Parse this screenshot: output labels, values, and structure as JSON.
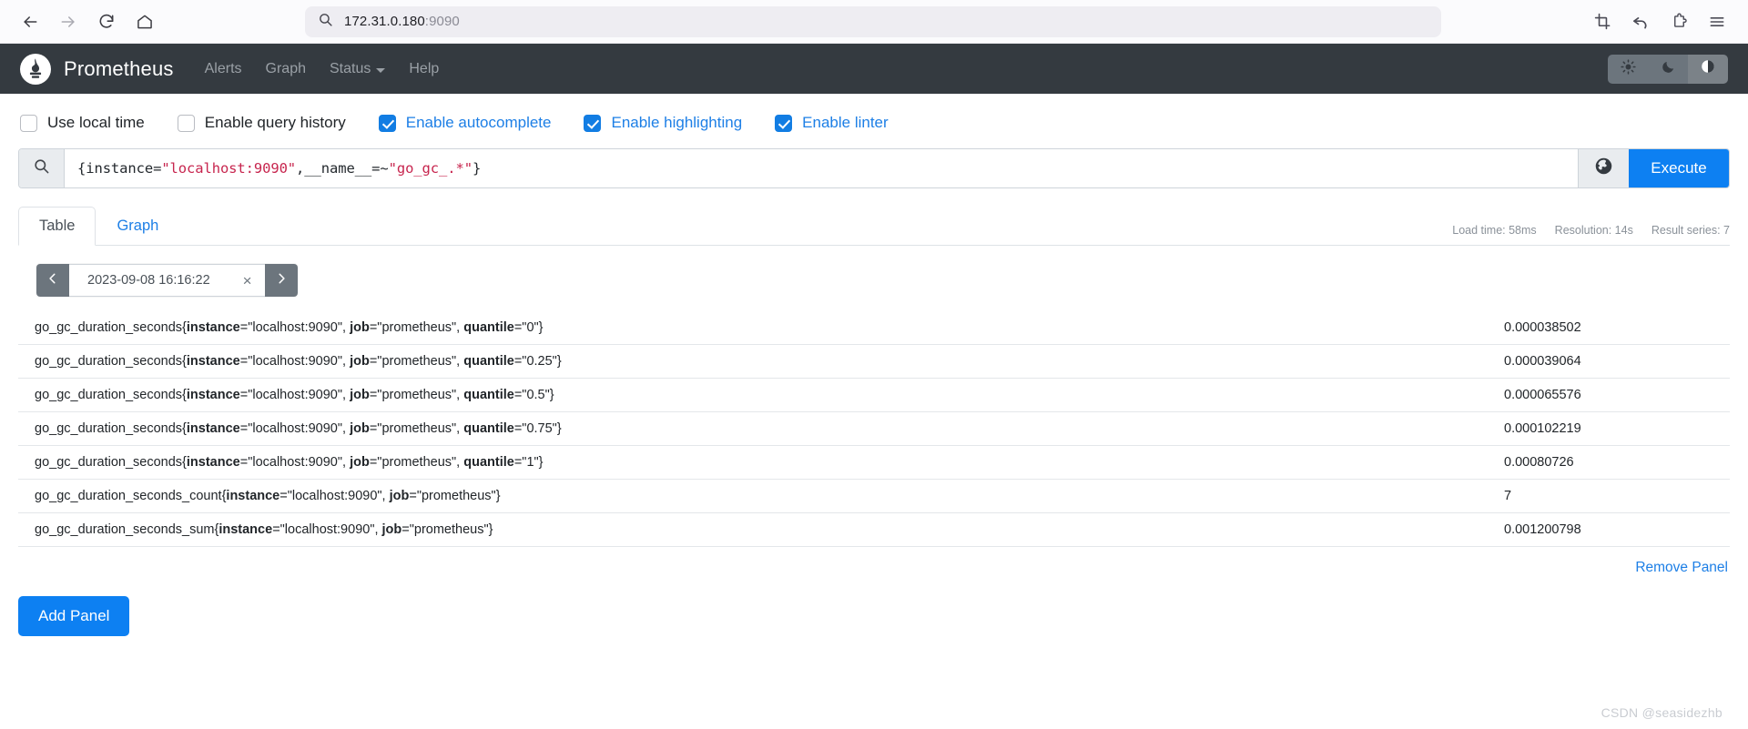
{
  "browser": {
    "url_host": "172.31.0.180",
    "url_port": ":9090",
    "back_icon": "back-arrow-icon",
    "forward_icon": "forward-arrow-icon",
    "reload_icon": "reload-icon",
    "home_icon": "home-icon",
    "search_icon": "search-icon",
    "capture_icon": "screenshot-capture-icon",
    "undo_icon": "undo-icon",
    "extensions_icon": "extensions-puzzle-icon",
    "menu_icon": "hamburger-menu-icon"
  },
  "navbar": {
    "brand": "Prometheus",
    "logo_icon": "prometheus-torch-logo",
    "links": [
      {
        "label": "Alerts",
        "has_caret": false
      },
      {
        "label": "Graph",
        "has_caret": false
      },
      {
        "label": "Status",
        "has_caret": true
      },
      {
        "label": "Help",
        "has_caret": false
      }
    ],
    "theme_buttons": [
      {
        "name": "light-theme-button",
        "icon": "sun-icon",
        "active": false
      },
      {
        "name": "dark-theme-button",
        "icon": "moon-icon",
        "active": false
      },
      {
        "name": "auto-theme-button",
        "icon": "half-circle-icon",
        "active": true
      }
    ]
  },
  "options": [
    {
      "label": "Use local time",
      "checked": false
    },
    {
      "label": "Enable query history",
      "checked": false
    },
    {
      "label": "Enable autocomplete",
      "checked": true
    },
    {
      "label": "Enable highlighting",
      "checked": true
    },
    {
      "label": "Enable linter",
      "checked": true
    }
  ],
  "query": {
    "search_icon": "search-icon",
    "globe_icon": "metrics-explorer-globe-icon",
    "execute_label": "Execute",
    "text": "{instance=\"localhost:9090\",__name__=~\"go_gc_.*\"}",
    "tokens": {
      "open_brace": "{",
      "label1": "instance",
      "eq1": "=",
      "val1": "\"localhost:9090\"",
      "comma": ",",
      "label2": "__name__",
      "eq2": "=~",
      "val2": "\"go_gc_.*\"",
      "close_brace": "}"
    }
  },
  "panel": {
    "tabs": [
      {
        "label": "Table",
        "active": true
      },
      {
        "label": "Graph",
        "active": false
      }
    ],
    "stats": {
      "load_time": "Load time: 58ms",
      "resolution": "Resolution: 14s",
      "result_series": "Result series: 7"
    },
    "time_picker": {
      "prev_icon": "chevron-left-icon",
      "next_icon": "chevron-right-icon",
      "value": "2023-09-08 16:16:22",
      "clear_label": "×"
    },
    "rows": [
      {
        "metric": "go_gc_duration_seconds",
        "labels": [
          {
            "key": "instance",
            "value": "\"localhost:9090\""
          },
          {
            "key": "job",
            "value": "\"prometheus\""
          },
          {
            "key": "quantile",
            "value": "\"0\""
          }
        ],
        "value": "0.000038502"
      },
      {
        "metric": "go_gc_duration_seconds",
        "labels": [
          {
            "key": "instance",
            "value": "\"localhost:9090\""
          },
          {
            "key": "job",
            "value": "\"prometheus\""
          },
          {
            "key": "quantile",
            "value": "\"0.25\""
          }
        ],
        "value": "0.000039064"
      },
      {
        "metric": "go_gc_duration_seconds",
        "labels": [
          {
            "key": "instance",
            "value": "\"localhost:9090\""
          },
          {
            "key": "job",
            "value": "\"prometheus\""
          },
          {
            "key": "quantile",
            "value": "\"0.5\""
          }
        ],
        "value": "0.000065576"
      },
      {
        "metric": "go_gc_duration_seconds",
        "labels": [
          {
            "key": "instance",
            "value": "\"localhost:9090\""
          },
          {
            "key": "job",
            "value": "\"prometheus\""
          },
          {
            "key": "quantile",
            "value": "\"0.75\""
          }
        ],
        "value": "0.000102219"
      },
      {
        "metric": "go_gc_duration_seconds",
        "labels": [
          {
            "key": "instance",
            "value": "\"localhost:9090\""
          },
          {
            "key": "job",
            "value": "\"prometheus\""
          },
          {
            "key": "quantile",
            "value": "\"1\""
          }
        ],
        "value": "0.00080726"
      },
      {
        "metric": "go_gc_duration_seconds_count",
        "labels": [
          {
            "key": "instance",
            "value": "\"localhost:9090\""
          },
          {
            "key": "job",
            "value": "\"prometheus\""
          }
        ],
        "value": "7"
      },
      {
        "metric": "go_gc_duration_seconds_sum",
        "labels": [
          {
            "key": "instance",
            "value": "\"localhost:9090\""
          },
          {
            "key": "job",
            "value": "\"prometheus\""
          }
        ],
        "value": "0.001200798"
      }
    ],
    "remove_panel_label": "Remove Panel"
  },
  "footer": {
    "add_panel_label": "Add Panel"
  },
  "watermark": "CSDN @seasidezhb",
  "colors": {
    "accent_blue": "#0d80f2",
    "link_blue": "#1d7fe6",
    "navbar_dark": "#343a40",
    "string_red": "#c7254e",
    "muted_gray": "#8a9199"
  }
}
